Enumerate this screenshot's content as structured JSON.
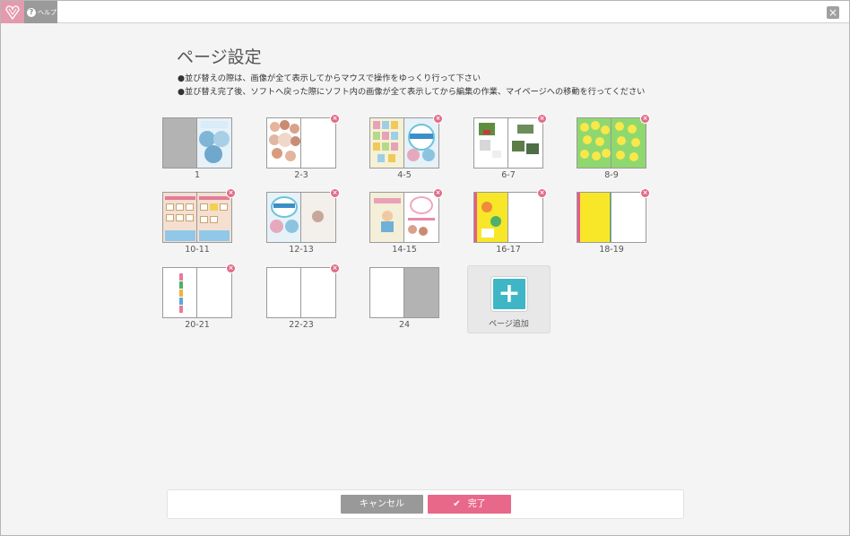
{
  "header": {
    "help_label": "ヘルプ",
    "close_symbol": "×"
  },
  "page": {
    "title": "ページ設定",
    "notes": [
      "●並び替えの際は、画像が全て表示してからマウスで操作をゆっくり行って下さい",
      "●並び替え完了後、ソフトへ戻った際にソフト内の画像が全て表示してから編集の作業、マイページへの移動を行ってください"
    ]
  },
  "pages": [
    {
      "label": "1"
    },
    {
      "label": "2-3"
    },
    {
      "label": "4-5"
    },
    {
      "label": "6-7"
    },
    {
      "label": "8-9"
    },
    {
      "label": "10-11"
    },
    {
      "label": "12-13"
    },
    {
      "label": "14-15"
    },
    {
      "label": "16-17"
    },
    {
      "label": "18-19"
    },
    {
      "label": "20-21"
    },
    {
      "label": "22-23"
    },
    {
      "label": "24"
    }
  ],
  "add_page": {
    "label": "ページ追加"
  },
  "footer": {
    "cancel_label": "キャンセル",
    "done_label": "完了"
  },
  "colors": {
    "accent_pink": "#e8688a",
    "add_button": "#3fb6c5",
    "cancel_grey": "#999999"
  }
}
